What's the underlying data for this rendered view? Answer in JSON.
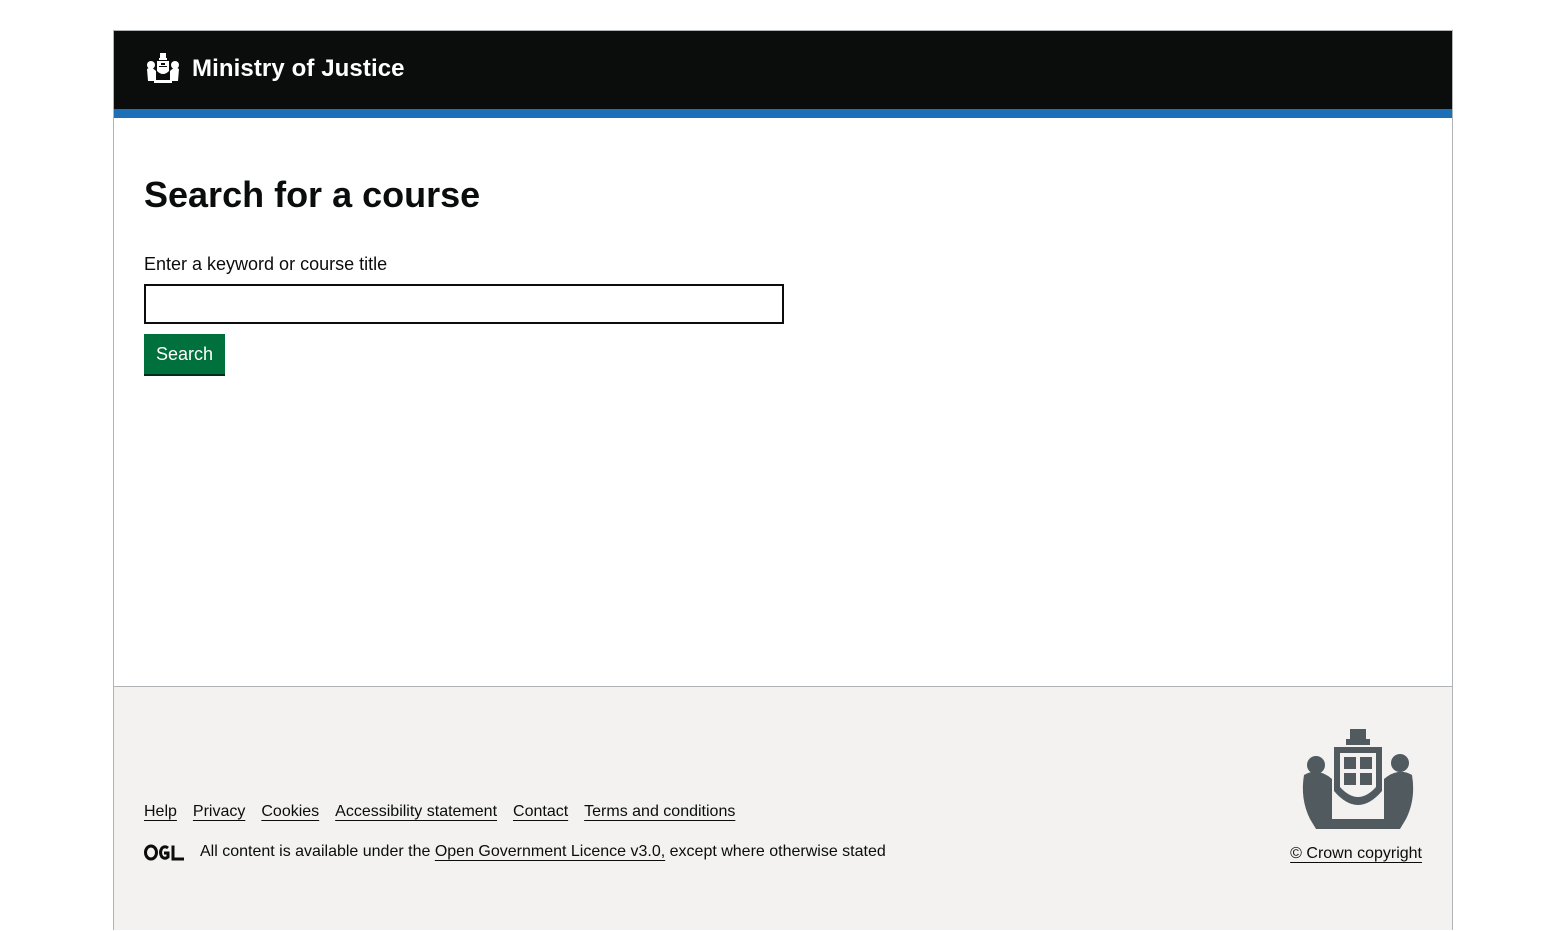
{
  "header": {
    "brand": "Ministry of Justice",
    "crest_icon": "royal-crest-icon",
    "background": "#0b0c0c",
    "accent_bar": "#1d70b8"
  },
  "main": {
    "title": "Search for a course",
    "search_label": "Enter a keyword or course title",
    "search_value": "",
    "search_button": "Search",
    "button_color": "#00703c"
  },
  "footer": {
    "links": [
      {
        "label": "Help"
      },
      {
        "label": "Privacy"
      },
      {
        "label": "Cookies"
      },
      {
        "label": "Accessibility statement"
      },
      {
        "label": "Contact"
      },
      {
        "label": "Terms and conditions"
      }
    ],
    "licence_prefix": "All content is available under the",
    "licence_link": "Open Government Licence v3.0,",
    "licence_suffix": "except where otherwise stated",
    "ogl_icon": "ogl-logo-icon",
    "copyright": "© Crown copyright",
    "crest_icon": "royal-coat-of-arms-icon",
    "background": "#f3f2f1"
  }
}
